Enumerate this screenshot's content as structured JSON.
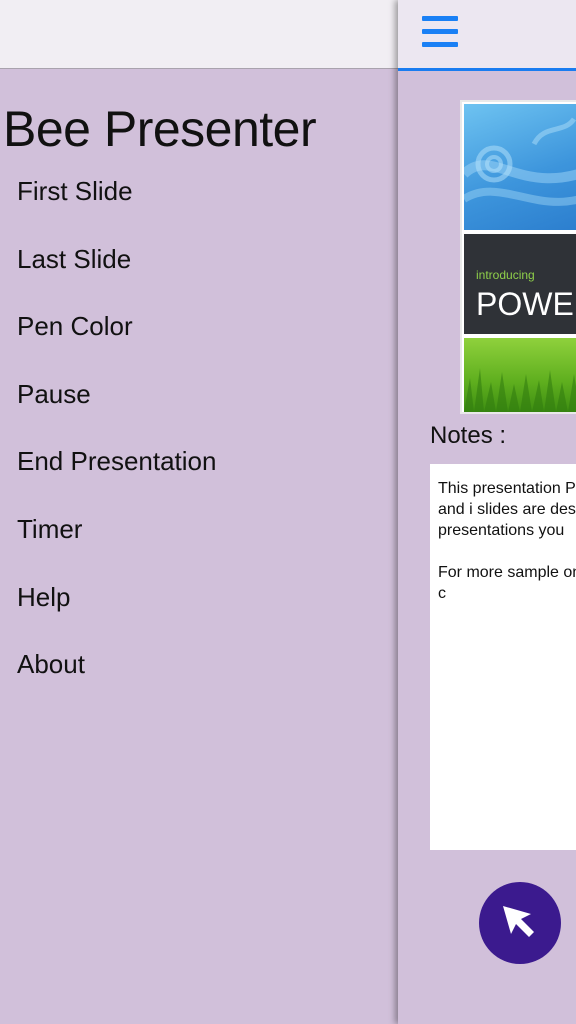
{
  "app_title": "Bee Presenter",
  "menu": [
    {
      "label": "First Slide"
    },
    {
      "label": "Last Slide"
    },
    {
      "label": "Pen Color"
    },
    {
      "label": "Pause"
    },
    {
      "label": "End Presentation"
    },
    {
      "label": "Timer"
    },
    {
      "label": "Help"
    },
    {
      "label": "About"
    }
  ],
  "slide": {
    "intro_text": "introducing",
    "title_text": "POWE"
  },
  "notes": {
    "label": "Notes :",
    "paragraph1": "This presentation PowerPoint and i slides are design presentations you",
    "paragraph2": "For more sample on the New tab, c"
  },
  "icons": {
    "menu": "hamburger-icon",
    "pointer": "pointer-arrow-icon"
  },
  "colors": {
    "background": "#d1c0da",
    "accent": "#1a80f5",
    "pointer_button": "#3b1a8e"
  }
}
